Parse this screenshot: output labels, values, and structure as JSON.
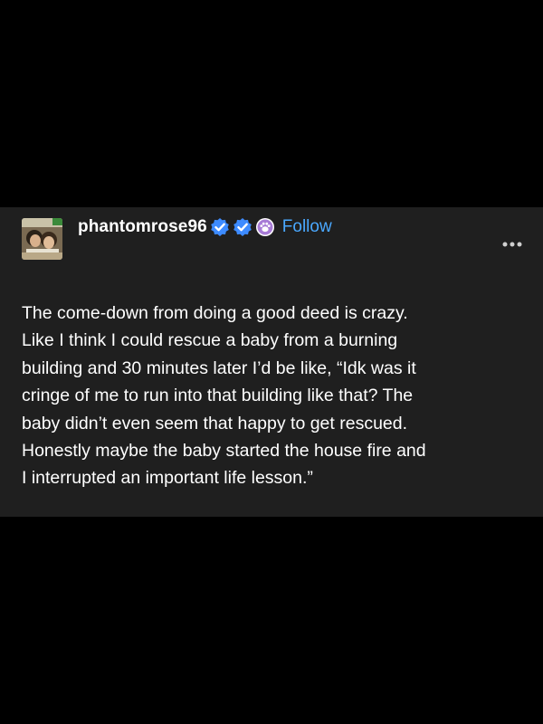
{
  "post": {
    "username": "phantomrose96",
    "follow_label": "Follow",
    "badges": [
      "verified-check-icon",
      "verified-check-icon",
      "paw-badge-icon"
    ],
    "more_icon": "ellipsis-icon",
    "body_lines": [
      "The come-down from doing a good deed is crazy.",
      "Like I think I could rescue a baby from a burning",
      "building and 30 minutes later I’d be like, “Idk was it",
      "cringe of me to run into that building like that? The",
      "baby didn’t even seem that happy to get rescued.",
      "Honestly maybe the baby started the house fire and",
      "I interrupted an important life lesson.”"
    ]
  },
  "colors": {
    "page_background": "#000000",
    "post_background": "#1f1f1f",
    "text": "#ffffff",
    "accent": "#4aa8ff"
  }
}
